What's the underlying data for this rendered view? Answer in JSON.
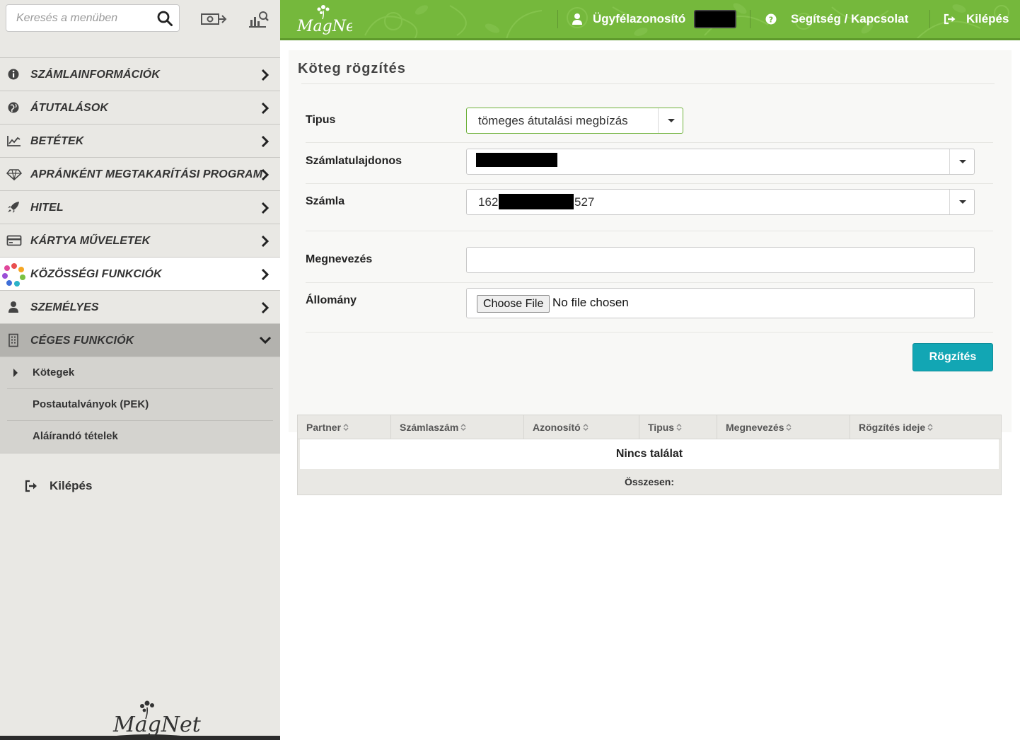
{
  "search": {
    "placeholder": "Keresés a menüben"
  },
  "sidebar": {
    "menu": [
      {
        "label": "SZÁMLAINFORMÁCIÓK",
        "icon": "info-icon"
      },
      {
        "label": "ÁTUTALÁSOK",
        "icon": "globe-icon"
      },
      {
        "label": "BETÉTEK",
        "icon": "line-chart-icon"
      },
      {
        "label": "APRÁNKÉNT MEGTAKARÍTÁSI PROGRAM",
        "icon": "diamond-icon"
      },
      {
        "label": "HITEL",
        "icon": "rocket-icon"
      },
      {
        "label": "KÁRTYA MŰVELETEK",
        "icon": "credit-card-icon"
      },
      {
        "label": "KÖZÖSSÉGI FUNKCIÓK",
        "icon": "community-icon"
      },
      {
        "label": "SZEMÉLYES",
        "icon": "user-icon"
      },
      {
        "label": "CÉGES FUNKCIÓK",
        "icon": "building-icon"
      }
    ],
    "submenu": [
      {
        "label": "Kötegek"
      },
      {
        "label": "Postautalványok (PEK)"
      },
      {
        "label": "Aláírandó tételek"
      }
    ],
    "logout_label": "Kilépés"
  },
  "header": {
    "logo_text": "MagNet",
    "client_id_label": "Ügyfélazonosító",
    "help_label": "Segítség / Kapcsolat",
    "logout_label": "Kilépés"
  },
  "form": {
    "title": "Köteg rögzítés",
    "type_label": "Tipus",
    "type_value": "tömeges átutalási megbízás",
    "owner_label": "Számlatulajdonos",
    "account_label": "Számla",
    "account_prefix": "162",
    "account_suffix": "527",
    "name_label": "Megnevezés",
    "name_value": "",
    "file_label": "Állomány",
    "file_button": "Choose File",
    "file_status": "No file chosen",
    "submit_label": "Rögzítés"
  },
  "table": {
    "columns": [
      "Partner",
      "Számlaszám",
      "Azonosító",
      "Tipus",
      "Megnevezés",
      "Rögzítés ideje"
    ],
    "empty_text": "Nincs találat",
    "footer_label": "Összesen:"
  },
  "colors": {
    "brand_green": "#75b83c",
    "accent_teal": "#12a6b4"
  }
}
